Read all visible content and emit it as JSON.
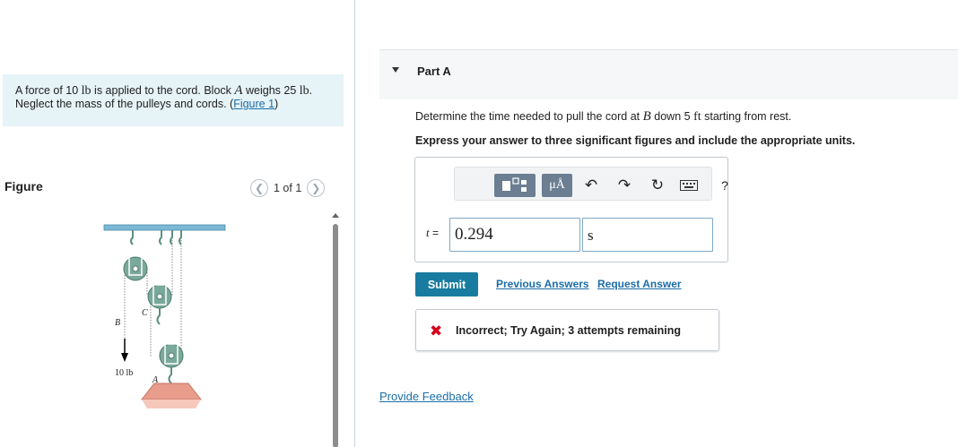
{
  "problem": {
    "text_1": "A force of 10 ",
    "unit_lb_1": "lb",
    "text_2": " is applied to the cord. Block ",
    "block": "A",
    "text_3": " weighs 25 ",
    "unit_lb_2": "lb",
    "text_4": ".",
    "text_5": "Neglect the mass of the pulleys and cords. (",
    "figure_link": "Figure 1",
    "text_6": ")"
  },
  "figure": {
    "title": "Figure",
    "pager": "1 of 1",
    "labels": {
      "B": "B",
      "C": "C",
      "A": "A",
      "force": "10 lb"
    }
  },
  "part": {
    "title": "Part A",
    "question_1": "Determine the time needed to pull the cord at ",
    "point": "B",
    "question_2": " down 5 ",
    "unit_ft": "ft",
    "question_3": " starting from rest.",
    "instruction": "Express your answer to three significant figures and include the appropriate units."
  },
  "toolbar": {
    "mu_label": "μÅ",
    "help_label": "?",
    "icons": [
      "template-icon",
      "undo-icon",
      "redo-icon",
      "reset-icon",
      "keyboard-icon",
      "help-icon"
    ]
  },
  "answer": {
    "var_name": "t",
    "equals": " =",
    "value": "0.294",
    "unit": "s"
  },
  "actions": {
    "submit": "Submit",
    "previous": "Previous Answers",
    "request": "Request Answer"
  },
  "feedback": {
    "icon": "✖",
    "text": "Incorrect; Try Again; 3 attempts remaining"
  },
  "provide_feedback": "Provide Feedback",
  "colors": {
    "accent": "#1a7ba0",
    "link": "#1a6ea8",
    "error": "#d6001c",
    "problem_bg": "#e6f3f7"
  }
}
